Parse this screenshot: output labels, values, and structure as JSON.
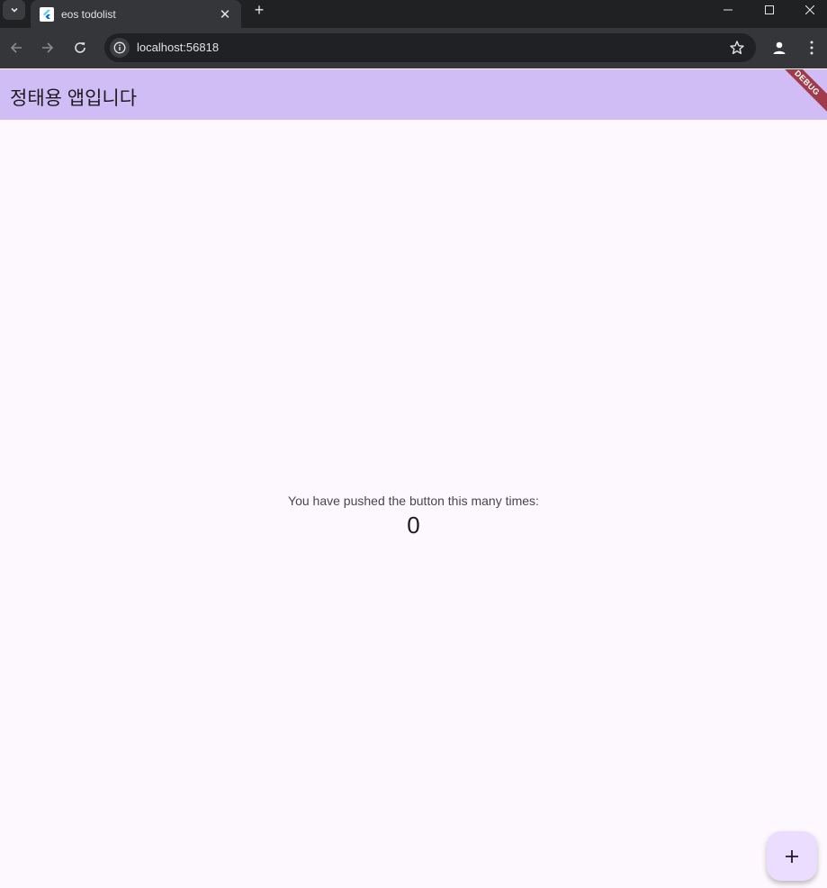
{
  "browser": {
    "tab_title": "eos todolist",
    "url": "localhost:56818",
    "tab_search_icon": "chevron-down-icon",
    "accent_color": "#35363a"
  },
  "app": {
    "title": "정태용 앱입니다",
    "debug_label": "DEBUG",
    "counter_label": "You have pushed the button this many times:",
    "counter_value": "0",
    "fab_icon": "plus-icon",
    "appbar_color": "#d1bdf5",
    "fab_color": "#eaddff",
    "background_color": "#fdf7fe"
  }
}
